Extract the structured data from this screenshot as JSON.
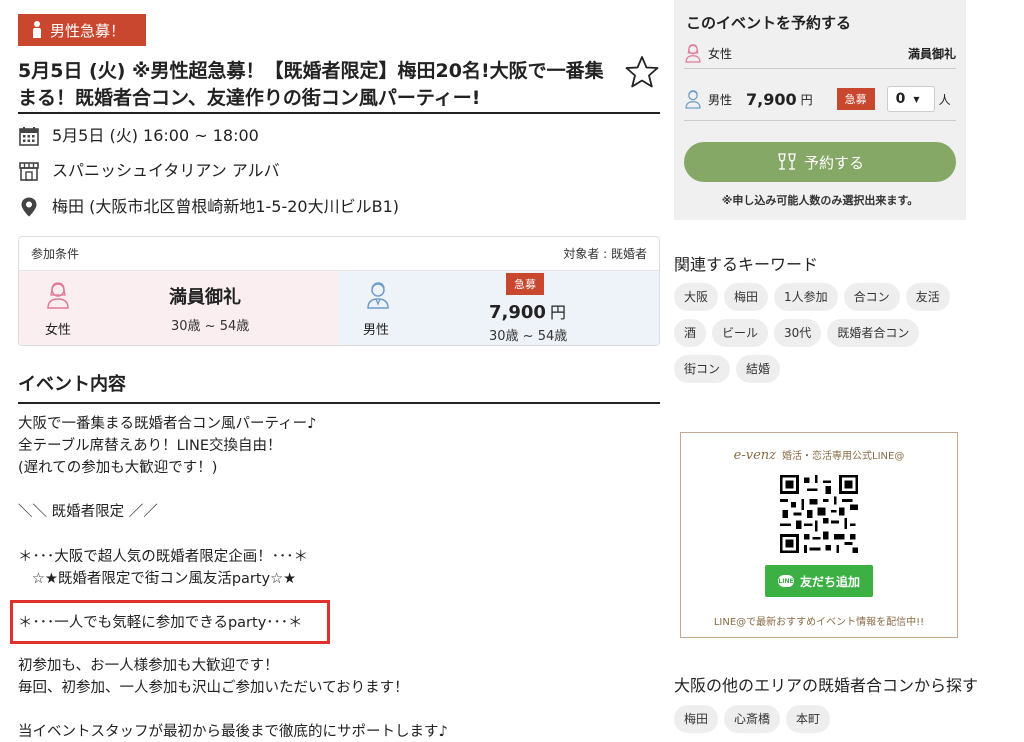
{
  "badge": "男性急募！",
  "title": "5月5日 (火) ※男性超急募！【既婚者限定】梅田20名!大阪で一番集まる！既婚者合コン、友達作りの街コン風パーティー!",
  "info": {
    "datetime": "5月5日 (火)  16:00 ~ 18:00",
    "venue": "スパニッシュイタリアン アルバ",
    "address": "梅田 (大阪市北区曾根崎新地1-5-20大川ビルB1)"
  },
  "conditions": {
    "header_left": "参加条件",
    "header_right": "対象者 : 既婚者",
    "female": {
      "label": "女性",
      "status": "満員御礼",
      "age": "30歳 ~ 54歳"
    },
    "male": {
      "label": "男性",
      "badge": "急募",
      "price": "7,900",
      "yen": "円",
      "age": "30歳 ~ 54歳"
    }
  },
  "section_title": "イベント内容",
  "body": {
    "p1": "大阪で一番集まる既婚者合コン風パーティー♪\n全テーブル席替えあり！LINE交換自由！\n(遅れての参加も大歓迎です！)",
    "p2": "＼＼ 既婚者限定 ／／",
    "p3": "＊･･･大阪で超人気の既婚者限定企画！･･･＊\n   ☆★既婚者限定で街コン風友活party☆★",
    "p4": "＊･･･一人でも気軽に参加できるparty･･･＊",
    "p5": "初参加も、お一人様参加も大歓迎です！\n毎回、初参加、一人参加も沢山ご参加いただいております！",
    "p6": "当イベントスタッフが最初から最後まで徹底的にサポートします♪"
  },
  "booking": {
    "title": "このイベントを予約する",
    "female_label": "女性",
    "female_status": "満員御礼",
    "male_label": "男性",
    "male_price": "7,900",
    "yen": "円",
    "badge": "急募",
    "qty": "0",
    "unit": "人",
    "button": "予約する",
    "note": "※申し込み可能人数のみ選択出来ます。"
  },
  "keywords": {
    "title": "関連するキーワード",
    "tags": [
      "大阪",
      "梅田",
      "1人参加",
      "合コン",
      "友活",
      "酒",
      "ビール",
      "30代",
      "既婚者合コン",
      "街コン",
      "結婚"
    ]
  },
  "line_promo": {
    "brand": "e-venz",
    "subtitle": "婚活・恋活専用公式LINE@",
    "button": "友だち追加",
    "line_icon_text": "LINE",
    "note": "LINE@で最新おすすめイベント情報を配信中!!"
  },
  "areas": {
    "title": "大阪の他のエリアの既婚者合コンから探す",
    "tags": [
      "梅田",
      "心斎橋",
      "本町"
    ]
  },
  "colors": {
    "accent_red": "#c8472e",
    "button_green": "#85a867",
    "line_green": "#3cb043",
    "highlight": "#e0322a"
  }
}
